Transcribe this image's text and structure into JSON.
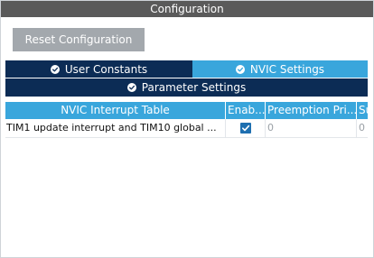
{
  "window": {
    "title": "Configuration"
  },
  "toolbar": {
    "reset_label": "Reset Configuration"
  },
  "tabs": {
    "user_constants": "User Constants",
    "nvic_settings": "NVIC Settings",
    "parameter_settings": "Parameter Settings",
    "active": "NVIC Settings"
  },
  "table": {
    "headers": [
      "NVIC Interrupt Table",
      "Enab...",
      "Preemption Pri...",
      "Su"
    ],
    "rows": [
      {
        "interrupt": "TIM1 update interrupt and TIM10 global ...",
        "enabled": true,
        "preemption_priority": "0",
        "sub_priority": "0"
      }
    ]
  },
  "colors": {
    "title_bar": "#5a5a5a",
    "tab_dark": "#0c2c55",
    "tab_active": "#39a6dc",
    "button": "#a3a8ad",
    "checkbox": "#1e6fb0"
  }
}
